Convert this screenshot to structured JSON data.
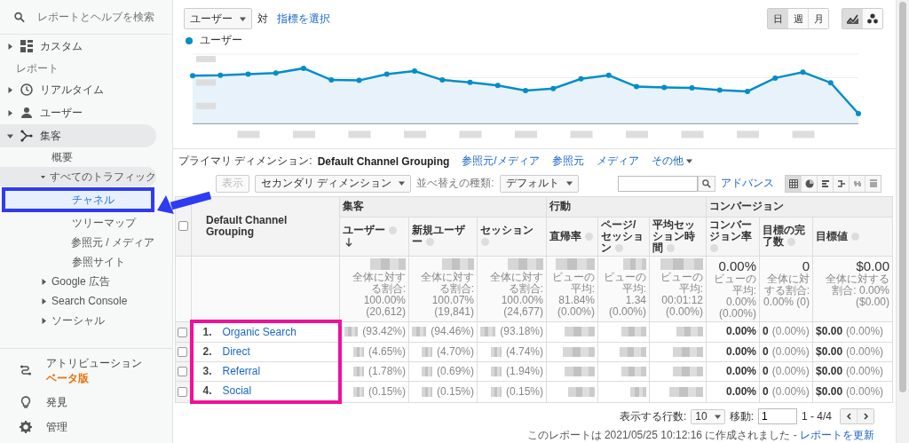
{
  "sidebar": {
    "search": {
      "placeholder": "レポートとヘルプを検索"
    },
    "custom": {
      "label": "カスタム",
      "expanded": false
    },
    "section_label": "レポート",
    "reports": [
      {
        "label": "リアルタイム",
        "expanded": false
      },
      {
        "label": "ユーザー",
        "expanded": false
      },
      {
        "label": "集客",
        "expanded": true,
        "children": [
          {
            "label": "概要",
            "selected": false
          },
          {
            "label": "すべてのトラフィック",
            "expanded": true,
            "children": [
              {
                "label": "チャネル",
                "selected": true
              },
              {
                "label": "ツリーマップ",
                "selected": false
              },
              {
                "label": "参照元 / メディア",
                "selected": false
              },
              {
                "label": "参照サイト",
                "selected": false
              }
            ]
          },
          {
            "label": "Google 広告",
            "expanded": false
          },
          {
            "label": "Search Console",
            "expanded": false
          },
          {
            "label": "ソーシャル",
            "expanded": false
          }
        ]
      }
    ],
    "bottom": [
      {
        "label": "アトリビューション",
        "badge": "ベータ版"
      },
      {
        "label": "発見"
      },
      {
        "label": "管理"
      }
    ]
  },
  "overview": {
    "metric": "ユーザー",
    "vs_label": "対",
    "compare_link": "指標を選択",
    "periods": [
      {
        "label": "日",
        "selected": true
      },
      {
        "label": "週",
        "selected": false
      },
      {
        "label": "月",
        "selected": false
      }
    ],
    "chart_types": [
      {
        "selected": true
      },
      {
        "selected": false
      }
    ],
    "legend": "ユーザー"
  },
  "dimension_bar": {
    "label": "プライマリ ディメンション:",
    "active": "Default Channel Grouping",
    "options": [
      "参照元/メディア",
      "参照元",
      "メディア",
      "その他"
    ]
  },
  "toolbar": {
    "plot_button": {
      "label": "表示",
      "disabled": true
    },
    "secondary_dimension": "セカンダリ ディメンション",
    "sort_label": "並べ替えの種類:",
    "sort_value": "デフォルト",
    "advanced_link": "アドバンス",
    "views": [
      {
        "selected": true
      },
      {
        "selected": false
      },
      {
        "selected": false
      },
      {
        "selected": false
      },
      {
        "selected": false
      },
      {
        "selected": false
      }
    ]
  },
  "table": {
    "header_checked": false,
    "dimension_header": "Default Channel Grouping",
    "groups": [
      {
        "label": "集客",
        "columns": [
          {
            "label": "ユーザー",
            "sorted": true
          },
          {
            "label": "新規ユーザー",
            "sorted": false
          },
          {
            "label": "セッション",
            "sorted": false
          }
        ]
      },
      {
        "label": "行動",
        "columns": [
          {
            "label": "直帰率",
            "sorted": false
          },
          {
            "label": "ページ/セッション",
            "sorted": false
          },
          {
            "label": "平均セッション時間",
            "sorted": false
          }
        ]
      },
      {
        "label": "コンバージョン",
        "columns": [
          {
            "label": "コンバージョン率",
            "sorted": false
          },
          {
            "label": "目標の完了数",
            "sorted": false
          },
          {
            "label": "目標値",
            "sorted": false
          }
        ]
      }
    ],
    "totals": [
      {
        "kind": "blurred",
        "note": "全体に対する割合: 100.00% (20,612)"
      },
      {
        "kind": "blurred",
        "note": "全体に対する割合: 100.07% (19,841)"
      },
      {
        "kind": "blurred",
        "note": "全体に対する割合: 100.00% (24,677)"
      },
      {
        "kind": "blurred",
        "note": "ビューの平均: 81.84% (0.00%)"
      },
      {
        "kind": "blurred",
        "note": "ビューの平均: 1.34 (0.00%)"
      },
      {
        "kind": "blurred",
        "note": "ビューの平均: 00:01:12 (0.00%)"
      },
      {
        "kind": "value",
        "value": "0.00%",
        "note": "ビューの平均: 0.00% (0.00%)"
      },
      {
        "kind": "value",
        "value": "0",
        "note": "全体に対する割合: 0.00% (0)"
      },
      {
        "kind": "value",
        "value": "$0.00",
        "note": "全体に対する割合: 0.00% ($0.00)"
      }
    ],
    "rows": [
      {
        "checked": false,
        "index": "1.",
        "label": "Organic Search",
        "cells": [
          {
            "kind": "blurred",
            "pct": "(93.42%)"
          },
          {
            "kind": "blurred",
            "pct": "(94.46%)"
          },
          {
            "kind": "blurred",
            "pct": "(93.18%)"
          },
          {
            "kind": "blurred"
          },
          {
            "kind": "blurred"
          },
          {
            "kind": "blurred"
          },
          {
            "kind": "value",
            "value": "0.00%"
          },
          {
            "kind": "value",
            "value": "0",
            "pct": "(0.00%)"
          },
          {
            "kind": "value",
            "value": "$0.00",
            "pct": "(0.00%)"
          }
        ]
      },
      {
        "checked": false,
        "index": "2.",
        "label": "Direct",
        "cells": [
          {
            "kind": "blurred",
            "pct": "(4.65%)"
          },
          {
            "kind": "blurred",
            "pct": "(4.70%)"
          },
          {
            "kind": "blurred",
            "pct": "(4.74%)"
          },
          {
            "kind": "blurred"
          },
          {
            "kind": "blurred"
          },
          {
            "kind": "blurred"
          },
          {
            "kind": "value",
            "value": "0.00%"
          },
          {
            "kind": "value",
            "value": "0",
            "pct": "(0.00%)"
          },
          {
            "kind": "value",
            "value": "$0.00",
            "pct": "(0.00%)"
          }
        ]
      },
      {
        "checked": false,
        "index": "3.",
        "label": "Referral",
        "cells": [
          {
            "kind": "blurred",
            "pct": "(1.78%)"
          },
          {
            "kind": "blurred",
            "pct": "(0.69%)"
          },
          {
            "kind": "blurred",
            "pct": "(1.94%)"
          },
          {
            "kind": "blurred"
          },
          {
            "kind": "blurred"
          },
          {
            "kind": "blurred"
          },
          {
            "kind": "value",
            "value": "0.00%"
          },
          {
            "kind": "value",
            "value": "0",
            "pct": "(0.00%)"
          },
          {
            "kind": "value",
            "value": "$0.00",
            "pct": "(0.00%)"
          }
        ]
      },
      {
        "checked": false,
        "index": "4.",
        "label": "Social",
        "cells": [
          {
            "kind": "blurred",
            "pct": "(0.15%)"
          },
          {
            "kind": "blurred",
            "pct": "(0.15%)"
          },
          {
            "kind": "blurred",
            "pct": "(0.15%)"
          },
          {
            "kind": "blurred"
          },
          {
            "kind": "blurred"
          },
          {
            "kind": "blurred"
          },
          {
            "kind": "value",
            "value": "0.00%"
          },
          {
            "kind": "value",
            "value": "0",
            "pct": "(0.00%)"
          },
          {
            "kind": "value",
            "value": "$0.00",
            "pct": "(0.00%)"
          }
        ]
      }
    ]
  },
  "footer": {
    "rows_label": "表示する行数:",
    "rows_value": "10",
    "goto_label": "移動:",
    "goto_value": "1",
    "range": "1 - 4/4",
    "report_note": "このレポートは 2021/05/25 10:12:16 に作成されました -",
    "refresh_link": "レポートを更新"
  }
}
